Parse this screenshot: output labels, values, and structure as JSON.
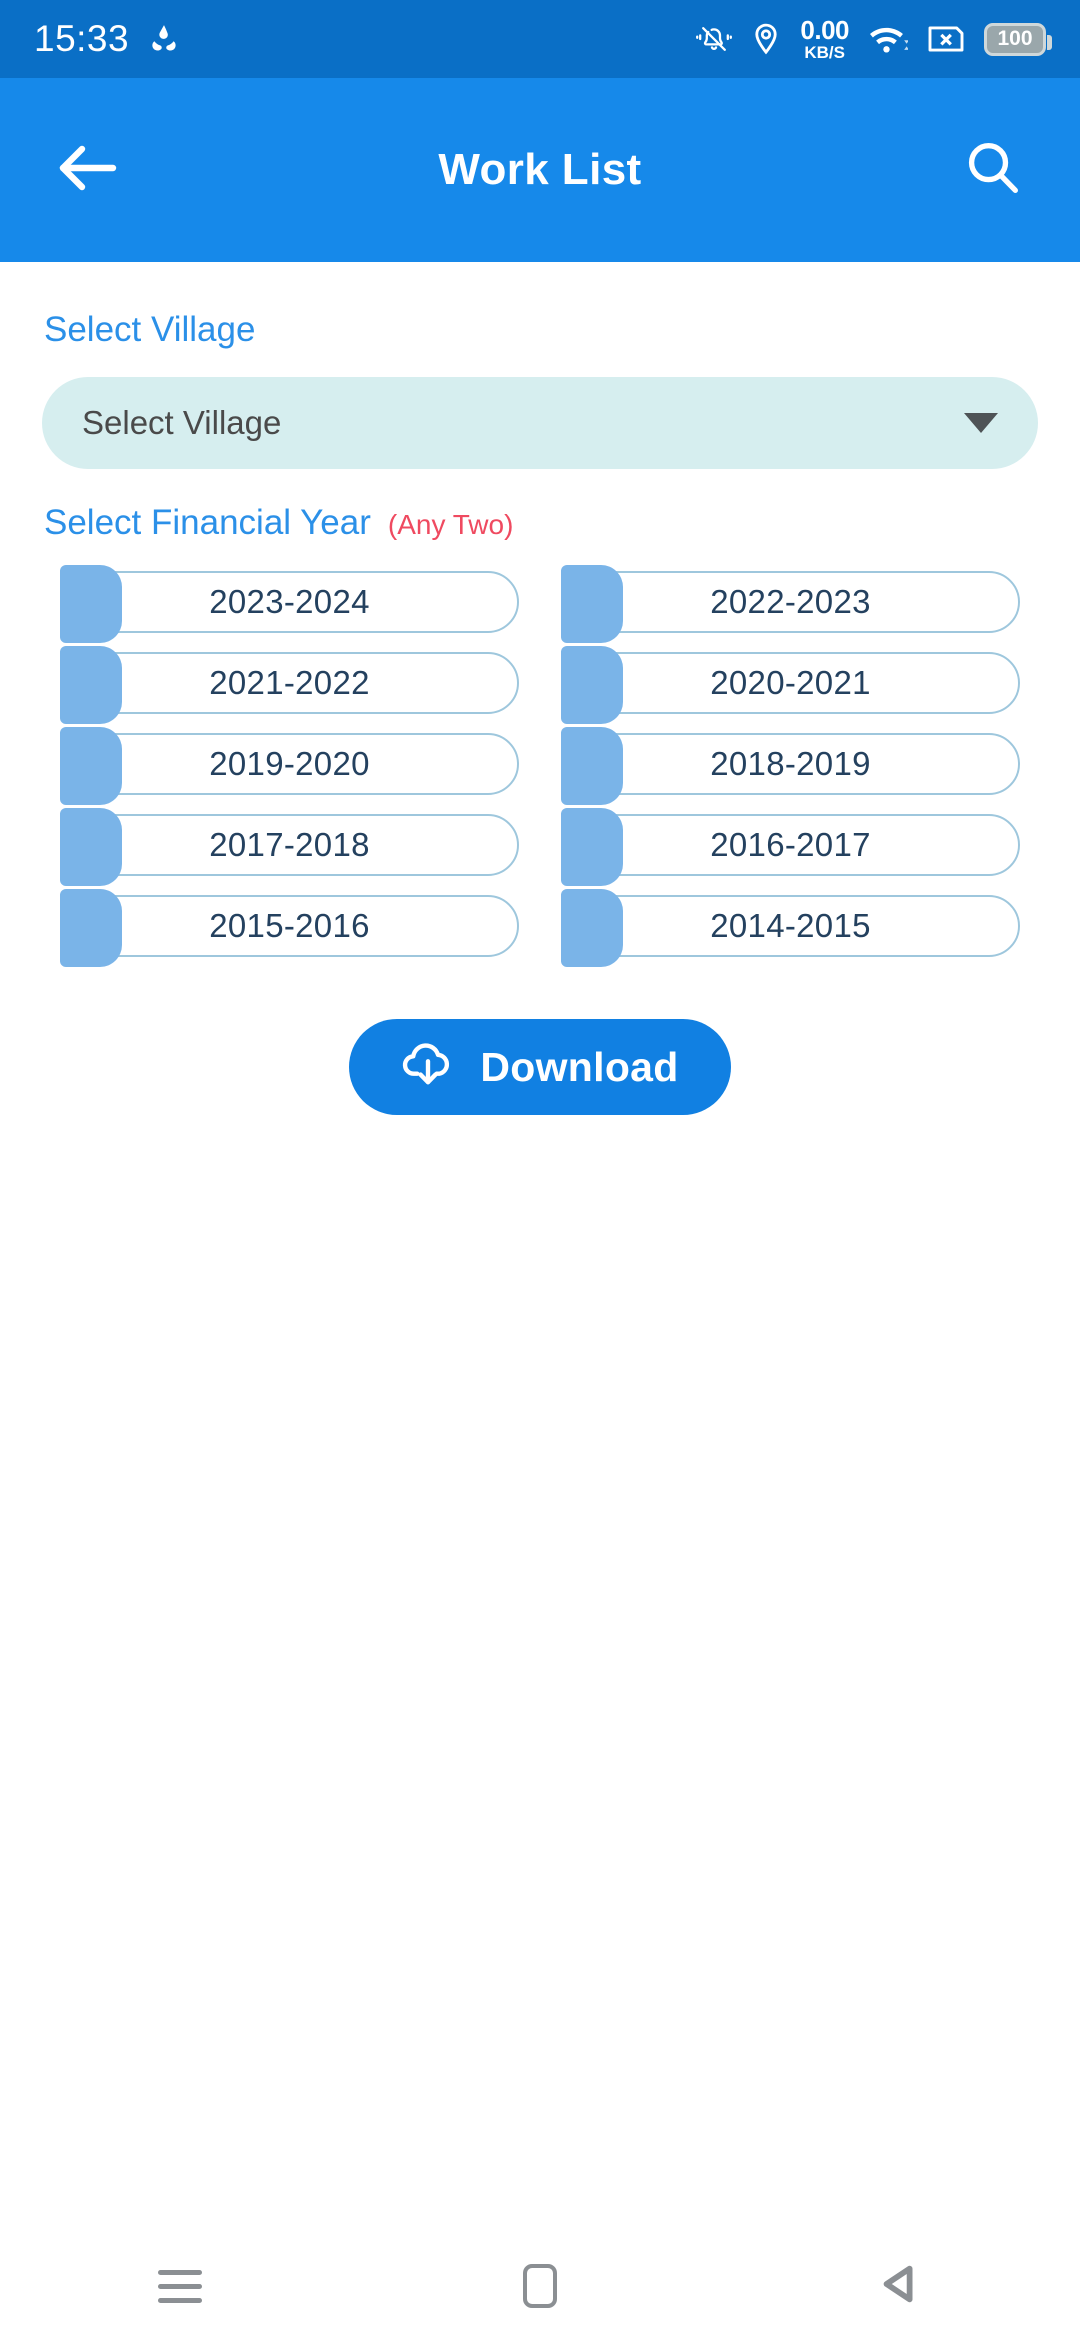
{
  "status_bar": {
    "time": "15:33",
    "sync_icon": "sync-icon",
    "mute_icon": "bell-mute-icon",
    "location_icon": "location-pin-icon",
    "net_speed_value": "0.00",
    "net_speed_unit": "KB/S",
    "wifi_icon": "wifi-icon",
    "sim_icon": "sim-card-disabled-icon",
    "battery_level": "100",
    "bg_color": "#0a6fc6"
  },
  "app_bar": {
    "title": "Work List",
    "back_icon": "back-arrow-icon",
    "search_icon": "search-icon",
    "bg_color": "#1689ea"
  },
  "village": {
    "label": "Select Village",
    "selected_value": "Select Village",
    "placeholder": "Select Village",
    "caret_icon": "chevron-down-icon",
    "field_bg": "#d6eeef",
    "label_color": "#2b90e8"
  },
  "financial_year": {
    "label": "Select Financial Year",
    "note": "(Any Two)",
    "note_color": "#ef4a60",
    "label_color": "#2b90e8",
    "options": [
      {
        "label": "2023-2024",
        "selected": false
      },
      {
        "label": "2022-2023",
        "selected": false
      },
      {
        "label": "2021-2022",
        "selected": false
      },
      {
        "label": "2020-2021",
        "selected": false
      },
      {
        "label": "2019-2020",
        "selected": false
      },
      {
        "label": "2018-2019",
        "selected": false
      },
      {
        "label": "2017-2018",
        "selected": false
      },
      {
        "label": "2016-2017",
        "selected": false
      },
      {
        "label": "2015-2016",
        "selected": false
      },
      {
        "label": "2014-2015",
        "selected": false
      }
    ]
  },
  "download": {
    "label": "Download",
    "icon": "cloud-download-icon",
    "bg_color": "#1180e2"
  },
  "nav_bar": {
    "recents_icon": "menu-recents-icon",
    "home_icon": "home-square-icon",
    "back_icon": "back-triangle-icon"
  }
}
